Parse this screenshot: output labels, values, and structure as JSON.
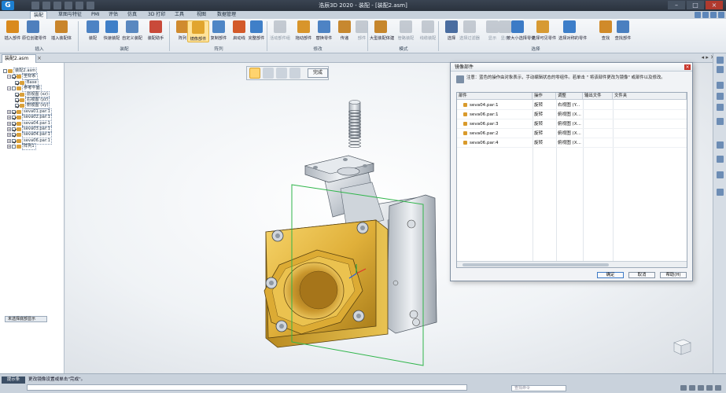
{
  "window": {
    "title": "浩辰3D 2020 - 装配 - [装配2.asm]"
  },
  "tabs": [
    {
      "label": "装配",
      "active": true
    },
    {
      "label": "草图与特征",
      "active": false
    },
    {
      "label": "PMI",
      "active": false
    },
    {
      "label": "评估",
      "active": false
    },
    {
      "label": "仿真",
      "active": false
    },
    {
      "label": "3D 打印",
      "active": false
    },
    {
      "label": "工具",
      "active": false
    },
    {
      "label": "视图",
      "active": false
    },
    {
      "label": "数据管理",
      "active": false
    }
  ],
  "ribbon": {
    "buttons": [
      {
        "label": "插入部件",
        "color": "#d98a1e"
      },
      {
        "label": "原位创建零件",
        "color": "#4e7fbd"
      },
      {
        "label": "插入装配体",
        "color": "#c9852b"
      },
      {
        "label": "装配",
        "color": "#4d83c4"
      },
      {
        "label": "快速装配",
        "color": "#3f7fc8"
      },
      {
        "label": "自定义装配",
        "color": "#5a88c0"
      },
      {
        "label": "装配助手",
        "color": "#c94a3a"
      },
      {
        "label": "阵列",
        "color": "#d08b2f"
      },
      {
        "label": "镜像部件",
        "color": "#e1a52e"
      },
      {
        "label": "复制部件",
        "color": "#4f86c6"
      },
      {
        "label": "启动线",
        "color": "#d35a2a"
      },
      {
        "label": "完整部件",
        "color": "#3f7fc8"
      },
      {
        "label": "活动部件组",
        "color": "#8a95a2"
      },
      {
        "label": "拖动部件",
        "color": "#d8952b"
      },
      {
        "label": "替换零件",
        "color": "#4d83c4"
      },
      {
        "label": "传递",
        "color": "#c7882f"
      },
      {
        "label": "部件",
        "color": "#8a95a2"
      },
      {
        "label": "大型装配体建",
        "color": "#c6862c"
      },
      {
        "label": "管路装配",
        "color": "#8a95a2"
      },
      {
        "label": "线缆装配",
        "color": "#8a95a2"
      },
      {
        "label": "选择",
        "color": "#4a6da0"
      },
      {
        "label": "选择过滤器",
        "color": "#8a95a2"
      },
      {
        "label": "显示",
        "color": "#8a95a2"
      },
      {
        "label": "显示",
        "color": "#8a95a2"
      },
      {
        "label": "按大小选择零件",
        "color": "#3c7bc6"
      },
      {
        "label": "选择可见零件",
        "color": "#d79a33"
      },
      {
        "label": "选择对称的零件",
        "color": "#3d7ec9"
      },
      {
        "label": "查找",
        "color": "#d08a2a"
      },
      {
        "label": "查找部件",
        "color": "#4a7fc0"
      }
    ],
    "groups": [
      "插入",
      "装配",
      "阵列",
      "修改",
      "模式",
      "选择"
    ]
  },
  "document": {
    "tab_label": "装配2.asm"
  },
  "tree": {
    "rows": [
      {
        "label": "装配2.asm",
        "indent": 0,
        "check": false,
        "expander": ""
      },
      {
        "label": "坐标系",
        "indent": 1,
        "check": true,
        "expander": "−"
      },
      {
        "label": "Base",
        "indent": 3,
        "check": true,
        "expander": ""
      },
      {
        "label": "参考平面",
        "indent": 1,
        "check": false,
        "expander": "−"
      },
      {
        "label": "前视图 (xz)",
        "indent": 3,
        "check": true,
        "expander": ""
      },
      {
        "label": "右视图 (yz)",
        "indent": 3,
        "check": true,
        "expander": ""
      },
      {
        "label": "俯视图 (xy)",
        "indent": 3,
        "check": true,
        "expander": ""
      },
      {
        "label": "seva01.par:1",
        "indent": 1,
        "check": true,
        "expander": "+"
      },
      {
        "label": "seva02.par:1",
        "indent": 1,
        "check": true,
        "expander": "+"
      },
      {
        "label": "seva04.par:1",
        "indent": 1,
        "check": true,
        "expander": "+"
      },
      {
        "label": "seva03.par:1",
        "indent": 1,
        "check": true,
        "expander": "+"
      },
      {
        "label": "seva04.par:1",
        "indent": 1,
        "check": true,
        "expander": "+"
      },
      {
        "label": "seva06.par:1",
        "indent": 1,
        "check": true,
        "expander": "+"
      },
      {
        "label": "阵列1",
        "indent": 1,
        "check": false,
        "expander": "+"
      }
    ],
    "show_tree_button": "未选择底部显示"
  },
  "commandbar": {
    "done_label": "完成"
  },
  "dialog": {
    "title": "镜像部件",
    "info": "注意：蓝色的操作由对象表示，手动编辑状态的零组件。若单击 \" 将该部件更改为镜像\" 或部件以及修改。",
    "columns": [
      "部件",
      "操作",
      "调整",
      "输出文件",
      "文件夹"
    ],
    "rows": [
      {
        "part": "seva04.par:1",
        "op": "旋转",
        "adjust": "右视图 (Y..."
      },
      {
        "part": "seva06.par:1",
        "op": "旋转",
        "adjust": "俯视图 (X..."
      },
      {
        "part": "seva06.par:3",
        "op": "旋转",
        "adjust": "俯视图 (X..."
      },
      {
        "part": "seva06.par:2",
        "op": "旋转",
        "adjust": "俯视图 (X..."
      },
      {
        "part": "seva06.par:4",
        "op": "旋转",
        "adjust": "俯视图 (X..."
      }
    ],
    "buttons": {
      "ok": "确定",
      "cancel": "取消",
      "help": "帮助(H)"
    }
  },
  "status": {
    "prompt_button": "提示条",
    "prompt_text": "更改镜像设置或单击\"完成\"。",
    "find_placeholder": "查找命令"
  },
  "colors": {
    "accent": "#ffd36e",
    "titlebar": "#2f3947",
    "part_gold": "#e3b53c"
  }
}
